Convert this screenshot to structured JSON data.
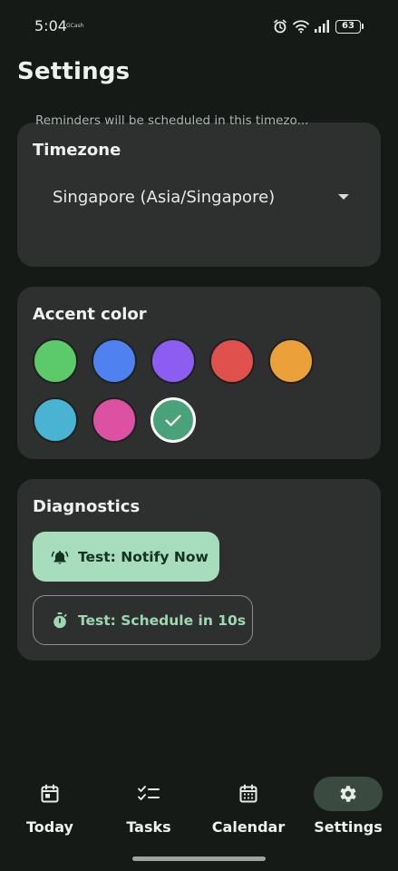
{
  "status_bar": {
    "time": "5:04",
    "app_badge": "GCash",
    "battery": "63",
    "icons": [
      "alarm-icon",
      "wifi-icon",
      "signal-icon",
      "battery-icon"
    ]
  },
  "page": {
    "title": "Settings"
  },
  "timezone": {
    "title": "Timezone",
    "selected": "Singapore (Asia/Singapore)",
    "helper": "Reminders will be scheduled in this timezo..."
  },
  "accent": {
    "title": "Accent color",
    "swatches": [
      {
        "name": "green",
        "color": "#5cc96a",
        "selected": false
      },
      {
        "name": "blue",
        "color": "#4f82f0",
        "selected": false
      },
      {
        "name": "purple",
        "color": "#8d5cf0",
        "selected": false
      },
      {
        "name": "red",
        "color": "#e0514e",
        "selected": false
      },
      {
        "name": "orange",
        "color": "#eba03a",
        "selected": false
      },
      {
        "name": "cyan",
        "color": "#4ab3d4",
        "selected": false
      },
      {
        "name": "pink",
        "color": "#dd51a2",
        "selected": false
      },
      {
        "name": "teal-green",
        "color": "#4aa27a",
        "selected": true
      }
    ]
  },
  "diagnostics": {
    "title": "Diagnostics",
    "notify_label": "Test: Notify Now",
    "schedule_label": "Test: Schedule in 10s"
  },
  "nav": {
    "items": [
      {
        "label": "Today",
        "icon": "calendar-today-icon",
        "active": false
      },
      {
        "label": "Tasks",
        "icon": "checklist-icon",
        "active": false
      },
      {
        "label": "Calendar",
        "icon": "calendar-month-icon",
        "active": false
      },
      {
        "label": "Settings",
        "icon": "gear-icon",
        "active": true
      }
    ]
  },
  "colors": {
    "background": "#151a17",
    "card": "#2d302e",
    "primary_container": "#a7dcbc",
    "primary": "#9fd6b4",
    "nav_active": "#3a4a41"
  }
}
